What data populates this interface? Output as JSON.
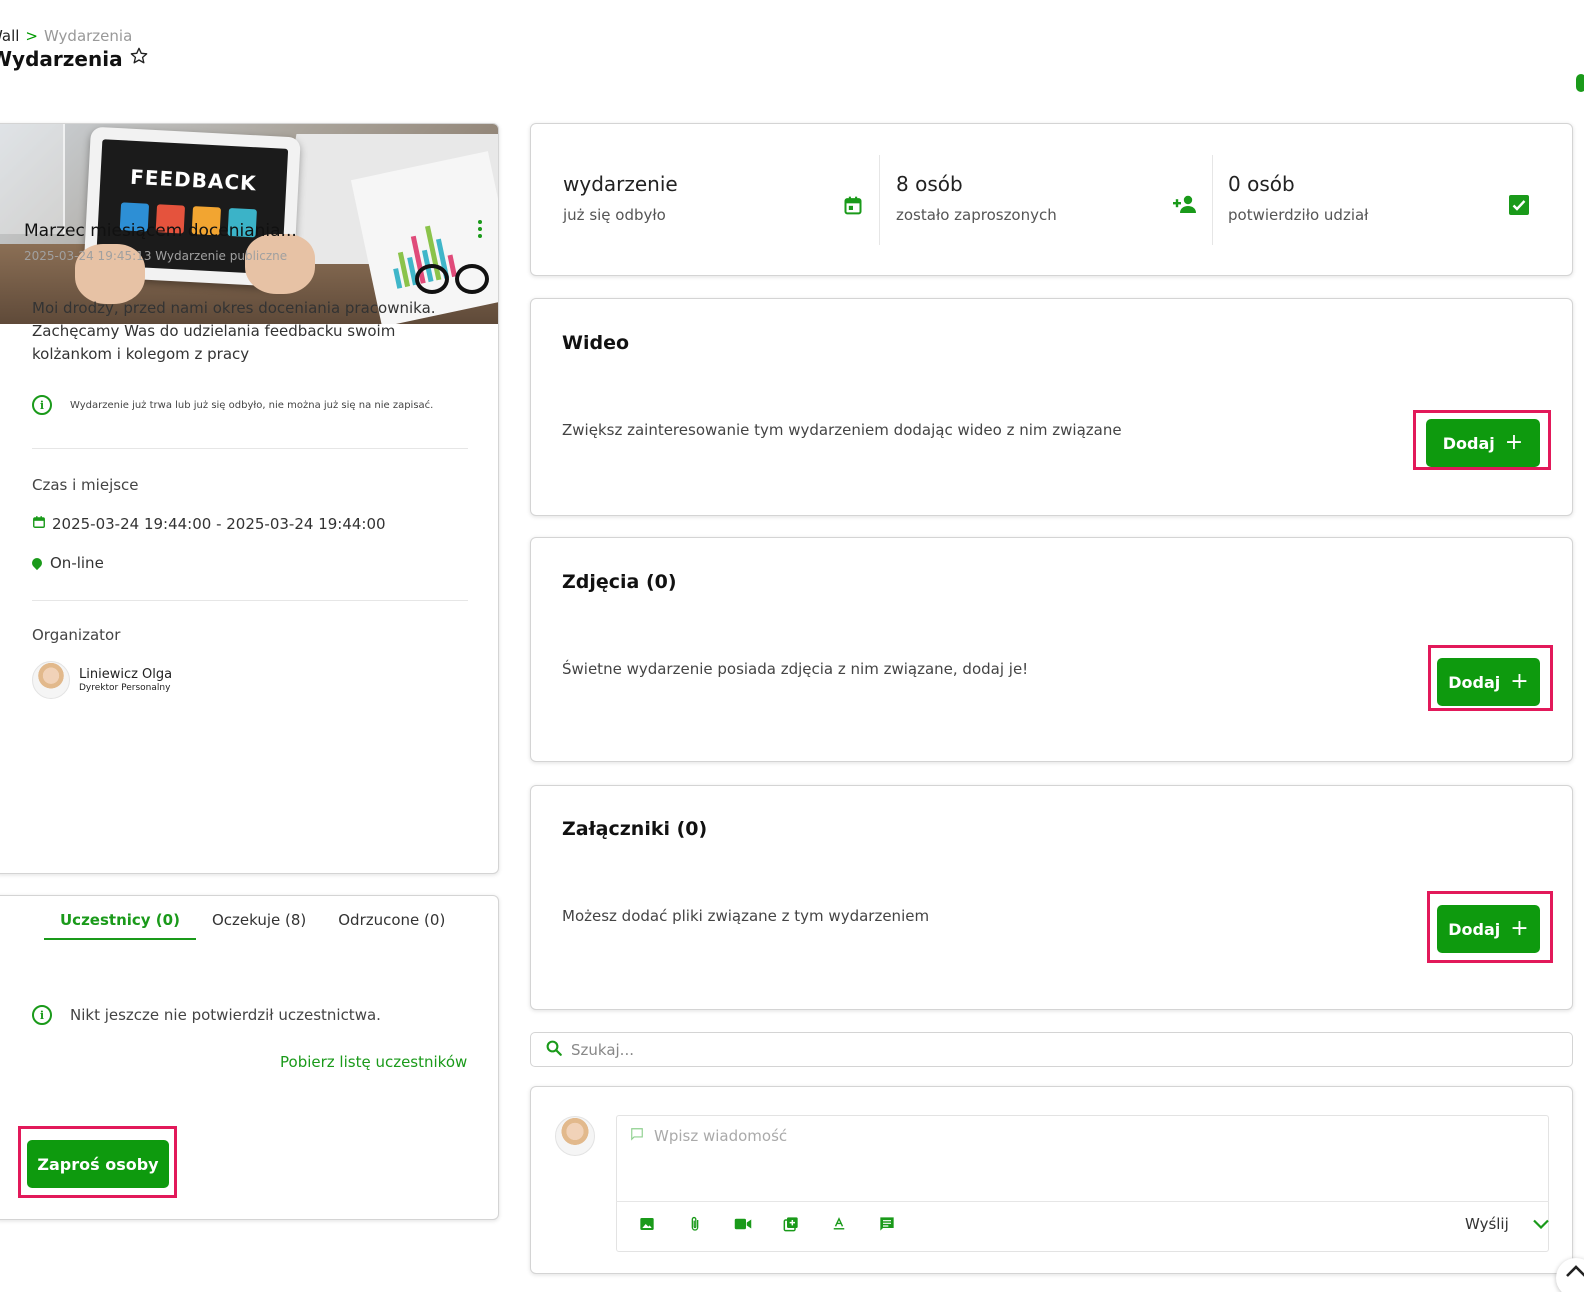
{
  "breadcrumb": {
    "root": "Wall",
    "separator": ">",
    "current": "Wydarzenia"
  },
  "page_title": "Wydarzenia",
  "event": {
    "title": "Marzec miesiącem doceniania...",
    "meta": "2025-03-24 19:45:13 Wydarzenie publiczne",
    "image_text": "FEEDBACK",
    "description": "Moi drodzy, przed nami okres doceniania pracownika. Zachęcamy Was do udzielania feedbacku swoim kolżankom i kolegom z pracy",
    "notice": "Wydarzenie już trwa lub już się odbyło, nie można już się na nie zapisać.",
    "time_place_label": "Czas i miejsce",
    "date_range": "2025-03-24 19:44:00 - 2025-03-24 19:44:00",
    "location": "On-line",
    "organizer_label": "Organizator",
    "organizer_name": "Liniewicz Olga",
    "organizer_role": "Dyrektor Personalny"
  },
  "participants": {
    "tabs": [
      {
        "label": "Uczestnicy (0)"
      },
      {
        "label": "Oczekuje (8)"
      },
      {
        "label": "Odrzucone (0)"
      }
    ],
    "empty_text": "Nikt jeszcze nie potwierdził uczestnictwa.",
    "download_link": "Pobierz listę uczestników",
    "invite_button": "Zaproś osoby"
  },
  "stats": [
    {
      "big": "wydarzenie",
      "small": "już się odbyło",
      "icon": "calendar-icon"
    },
    {
      "big": "8 osób",
      "small": "zostało zaproszonych",
      "icon": "person-add-icon"
    },
    {
      "big": "0 osób",
      "small": "potwierdziło udział",
      "icon": "checkbox-icon"
    }
  ],
  "sections": {
    "video": {
      "title": "Wideo",
      "text": "Zwiększ zainteresowanie tym wydarzeniem dodając wideo z nim związane",
      "button": "Dodaj"
    },
    "photos": {
      "title": "Zdjęcia (0)",
      "text": "Świetne wydarzenie posiada zdjęcia z nim związane, dodaj je!",
      "button": "Dodaj"
    },
    "attachments": {
      "title": "Załączniki (0)",
      "text": "Możesz dodać pliki związane z tym wydarzeniem",
      "button": "Dodaj"
    }
  },
  "search": {
    "placeholder": "Szukaj..."
  },
  "comment": {
    "placeholder": "Wpisz wiadomość",
    "send_label": "Wyślij",
    "tools": [
      "image-icon",
      "paperclip-icon",
      "video-icon",
      "add-box-icon",
      "text-format-icon",
      "comment-icon"
    ]
  },
  "colors": {
    "accent": "#0e9a0e",
    "highlight": "#e2195a"
  }
}
